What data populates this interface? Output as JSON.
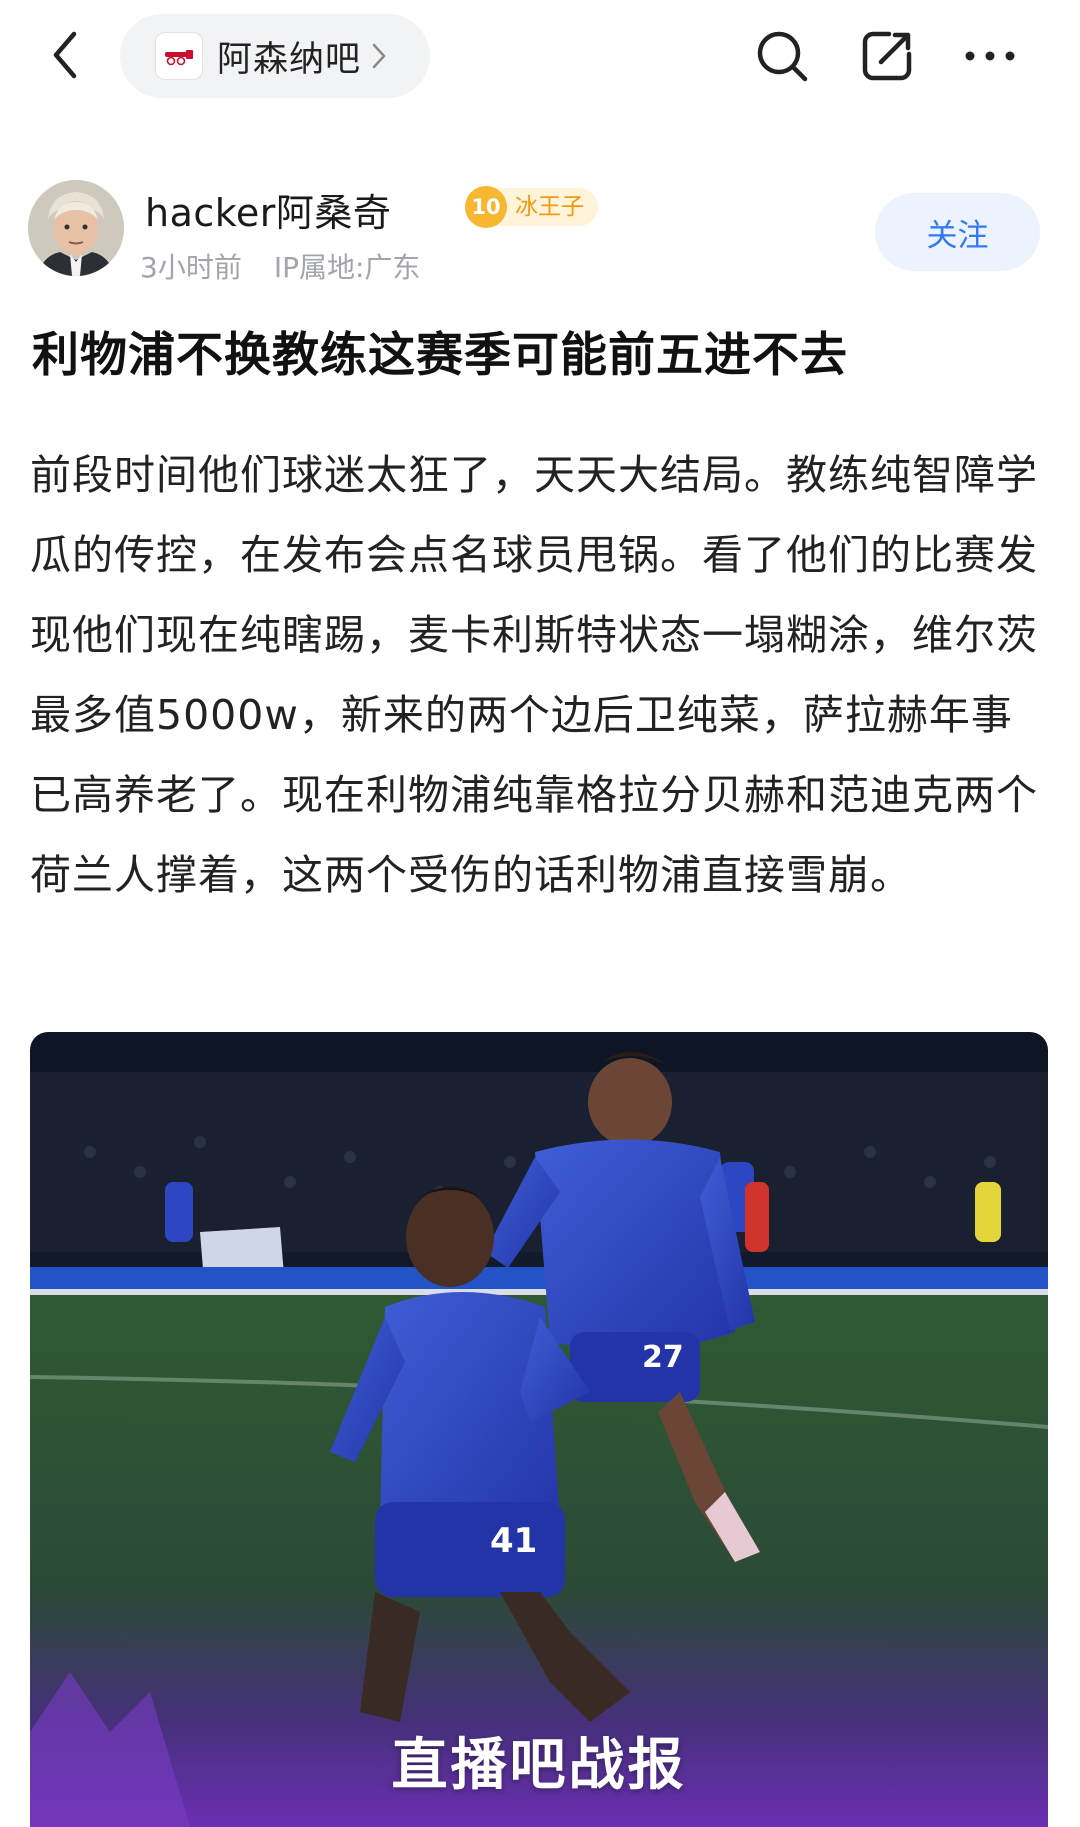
{
  "topbar": {
    "back_icon": "chevron-left-icon",
    "forum_name": "阿森纳吧",
    "forum_logo": "arsenal-cannon-logo",
    "icons": [
      "search-icon",
      "edit-share-icon",
      "more-icon"
    ]
  },
  "author": {
    "name": "hacker阿桑奇",
    "level": "10",
    "level_title": "冰王子",
    "time": "3小时前",
    "ip_location": "IP属地:广东",
    "follow_label": "关注"
  },
  "post": {
    "title": "利物浦不换教练这赛季可能前五进不去",
    "body": "前段时间他们球迷太狂了，天天大结局。教练纯智障学瓜的传控，在发布会点名球员甩锅。看了他们的比赛发现他们现在纯瞎踢，麦卡利斯特状态一塌糊涂，维尔茨最多值5000w，新来的两个边后卫纯菜，萨拉赫年事已高养老了。现在利物浦纯靠格拉分贝赫和范迪克两个荷兰人撑着，这两个受伤的话利物浦直接雪崩。",
    "image_watermark": "直播吧战报",
    "image_numbers": [
      "41",
      "27"
    ]
  },
  "colors": {
    "accent_blue": "#3478f6",
    "follow_bg": "#edf3fe",
    "badge_orange": "#f29a0f",
    "pill_bg": "#f2f3f5",
    "meta_gray": "#a2a5ab"
  }
}
